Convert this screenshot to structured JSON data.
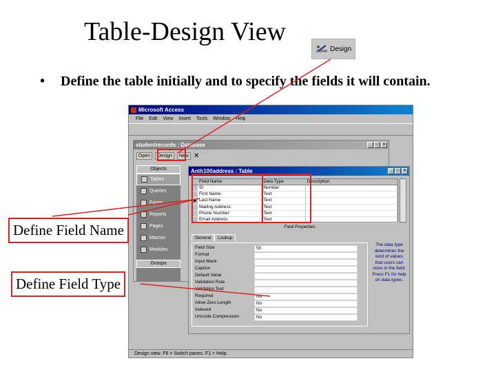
{
  "slide": {
    "title": "Table-Design View",
    "design_badge_label": "Design",
    "bullet": "•",
    "bullet_text": "Define the table initially and to specify the fields it will contain.",
    "label_field_name": "Define Field Name",
    "label_field_type": "Define Field Type"
  },
  "access": {
    "title": "Microsoft Access",
    "menu": [
      "File",
      "Edit",
      "View",
      "Insert",
      "Tools",
      "Window",
      "Help"
    ],
    "db_window": {
      "title": "studentrecords : Database",
      "open_label": "Open",
      "design_label": "Design",
      "new_label": "New",
      "objects_header": "Objects",
      "objects": [
        "Tables",
        "Queries",
        "Forms",
        "Reports",
        "Pages",
        "Macros",
        "Modules"
      ],
      "groups_header": "Groups"
    },
    "table_window": {
      "title": "Anth100address : Table",
      "columns": [
        "Field Name",
        "Data Type",
        "Description"
      ],
      "rows": [
        {
          "field": "ID",
          "type": "Number"
        },
        {
          "field": "First Name",
          "type": "Text"
        },
        {
          "field": "Last Name",
          "type": "Text"
        },
        {
          "field": "Mailing Address",
          "type": "Text"
        },
        {
          "field": "Phone Number",
          "type": "Text"
        },
        {
          "field": "Email Address",
          "type": "Text"
        }
      ],
      "field_properties_label": "Field Properties",
      "tab_general": "General",
      "tab_lookup": "Lookup",
      "properties": [
        {
          "label": "Field Size",
          "value": "50"
        },
        {
          "label": "Format",
          "value": ""
        },
        {
          "label": "Input Mask",
          "value": ""
        },
        {
          "label": "Caption",
          "value": ""
        },
        {
          "label": "Default Value",
          "value": ""
        },
        {
          "label": "Validation Rule",
          "value": ""
        },
        {
          "label": "Validation Text",
          "value": ""
        },
        {
          "label": "Required",
          "value": "No"
        },
        {
          "label": "Allow Zero Length",
          "value": "No"
        },
        {
          "label": "Indexed",
          "value": "No"
        },
        {
          "label": "Unicode Compression",
          "value": "No"
        }
      ],
      "help_text": "The data type determines the kind of values that users can store in the field. Press F1 for help on data types."
    },
    "status": "Design view. F6 = Switch panes. F1 = Help."
  },
  "colors": {
    "accent_red": "#dd2222",
    "titlebar_blue": "#000080"
  }
}
